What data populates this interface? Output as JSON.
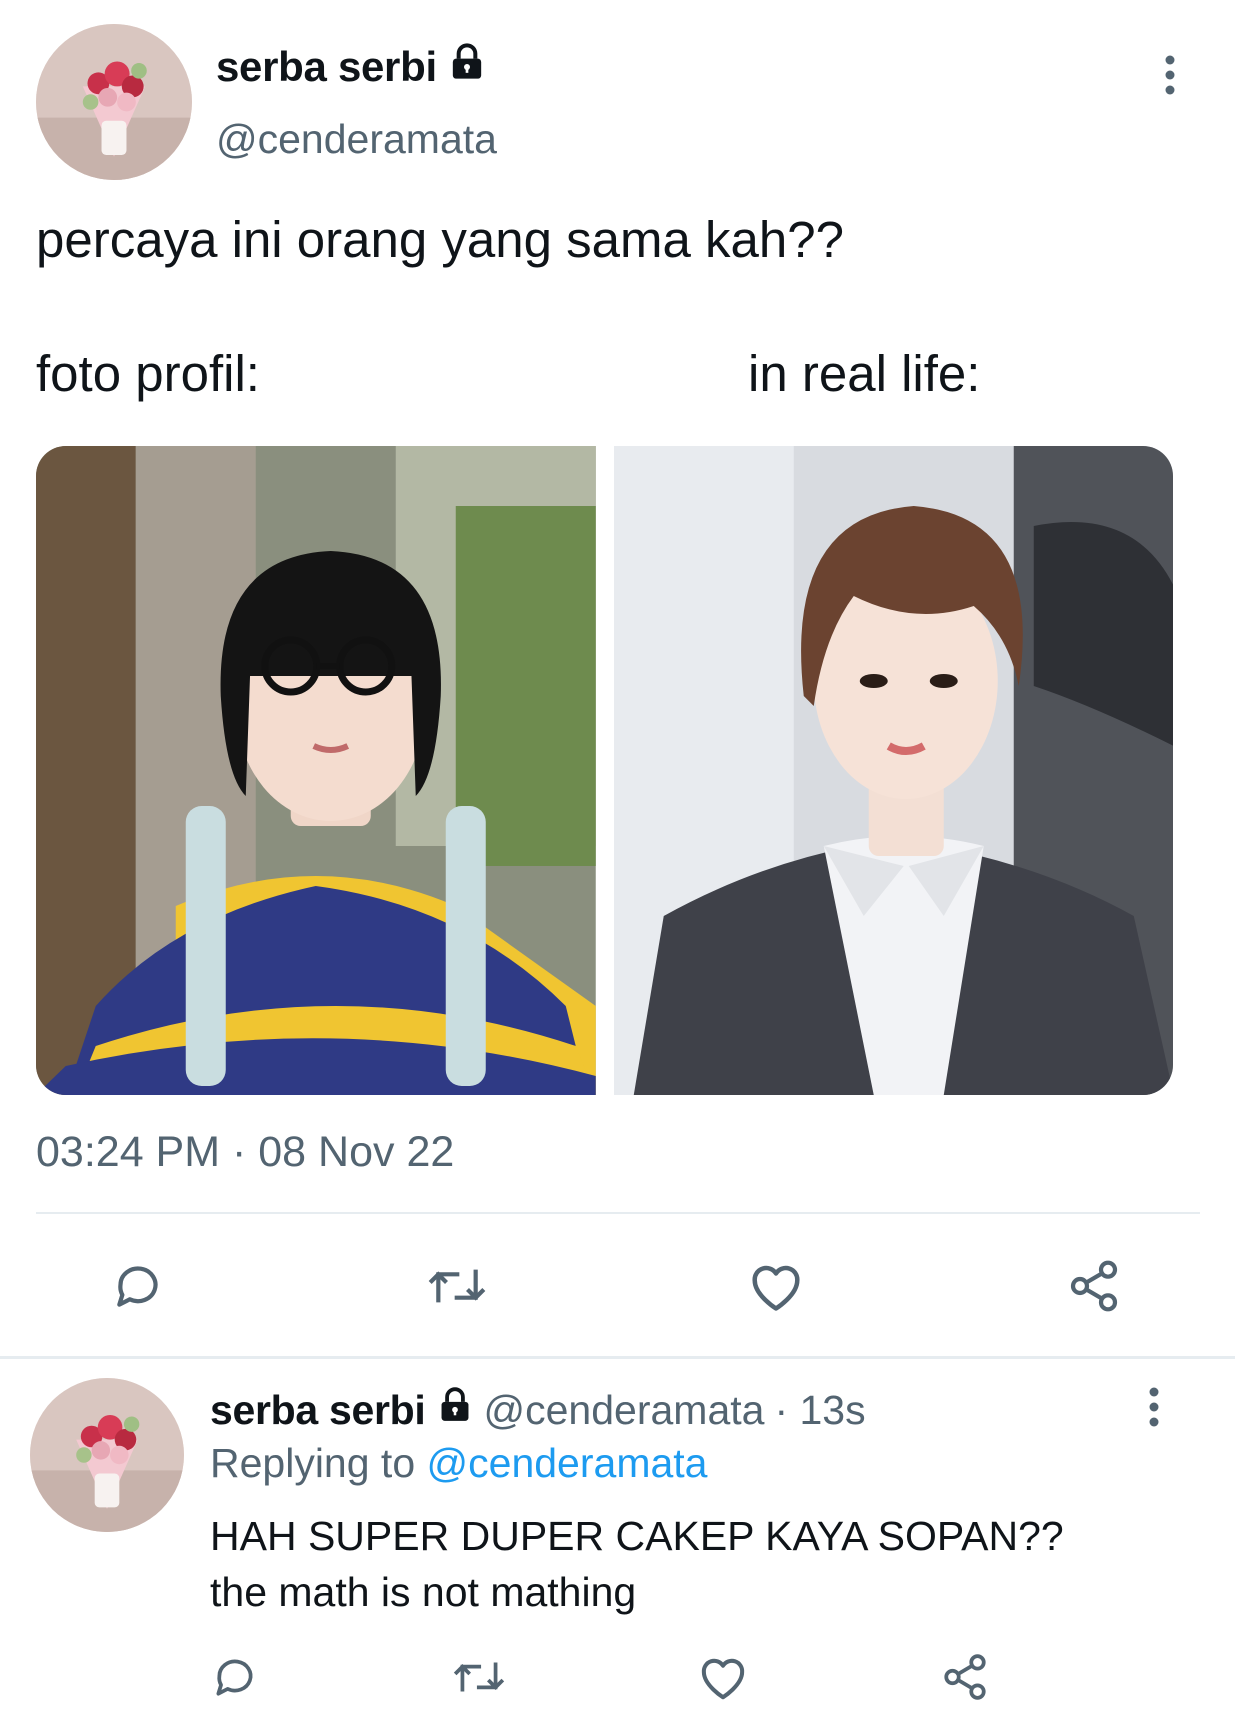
{
  "tweet": {
    "author": {
      "display_name": "serba serbi",
      "handle": "@cenderamata",
      "protected_icon": "lock-icon"
    },
    "text": "percaya ini orang yang sama kah??",
    "labels": {
      "left": "foto profil:",
      "right": "in real life:"
    },
    "media": [
      {
        "description_icon": "photo"
      },
      {
        "description_icon": "photo"
      }
    ],
    "timestamp": "03:24 PM · 08 Nov 22",
    "actions": [
      "reply-icon",
      "retweet-icon",
      "like-icon",
      "share-icon"
    ]
  },
  "reply": {
    "author": {
      "display_name": "serba serbi",
      "handle": "@cenderamata",
      "time": "· 13s"
    },
    "replying_prefix": "Replying to",
    "replying_to": "@cenderamata",
    "text_line1": "HAH SUPER DUPER CAKEP KAYA SOPAN??",
    "text_line2": "the math is not mathing",
    "actions": [
      "reply-icon",
      "retweet-icon",
      "like-icon",
      "share-icon"
    ]
  },
  "colors": {
    "text": "#0f1419",
    "secondary": "#536471",
    "link": "#1d9bf0",
    "divider": "#e6ecf0"
  }
}
